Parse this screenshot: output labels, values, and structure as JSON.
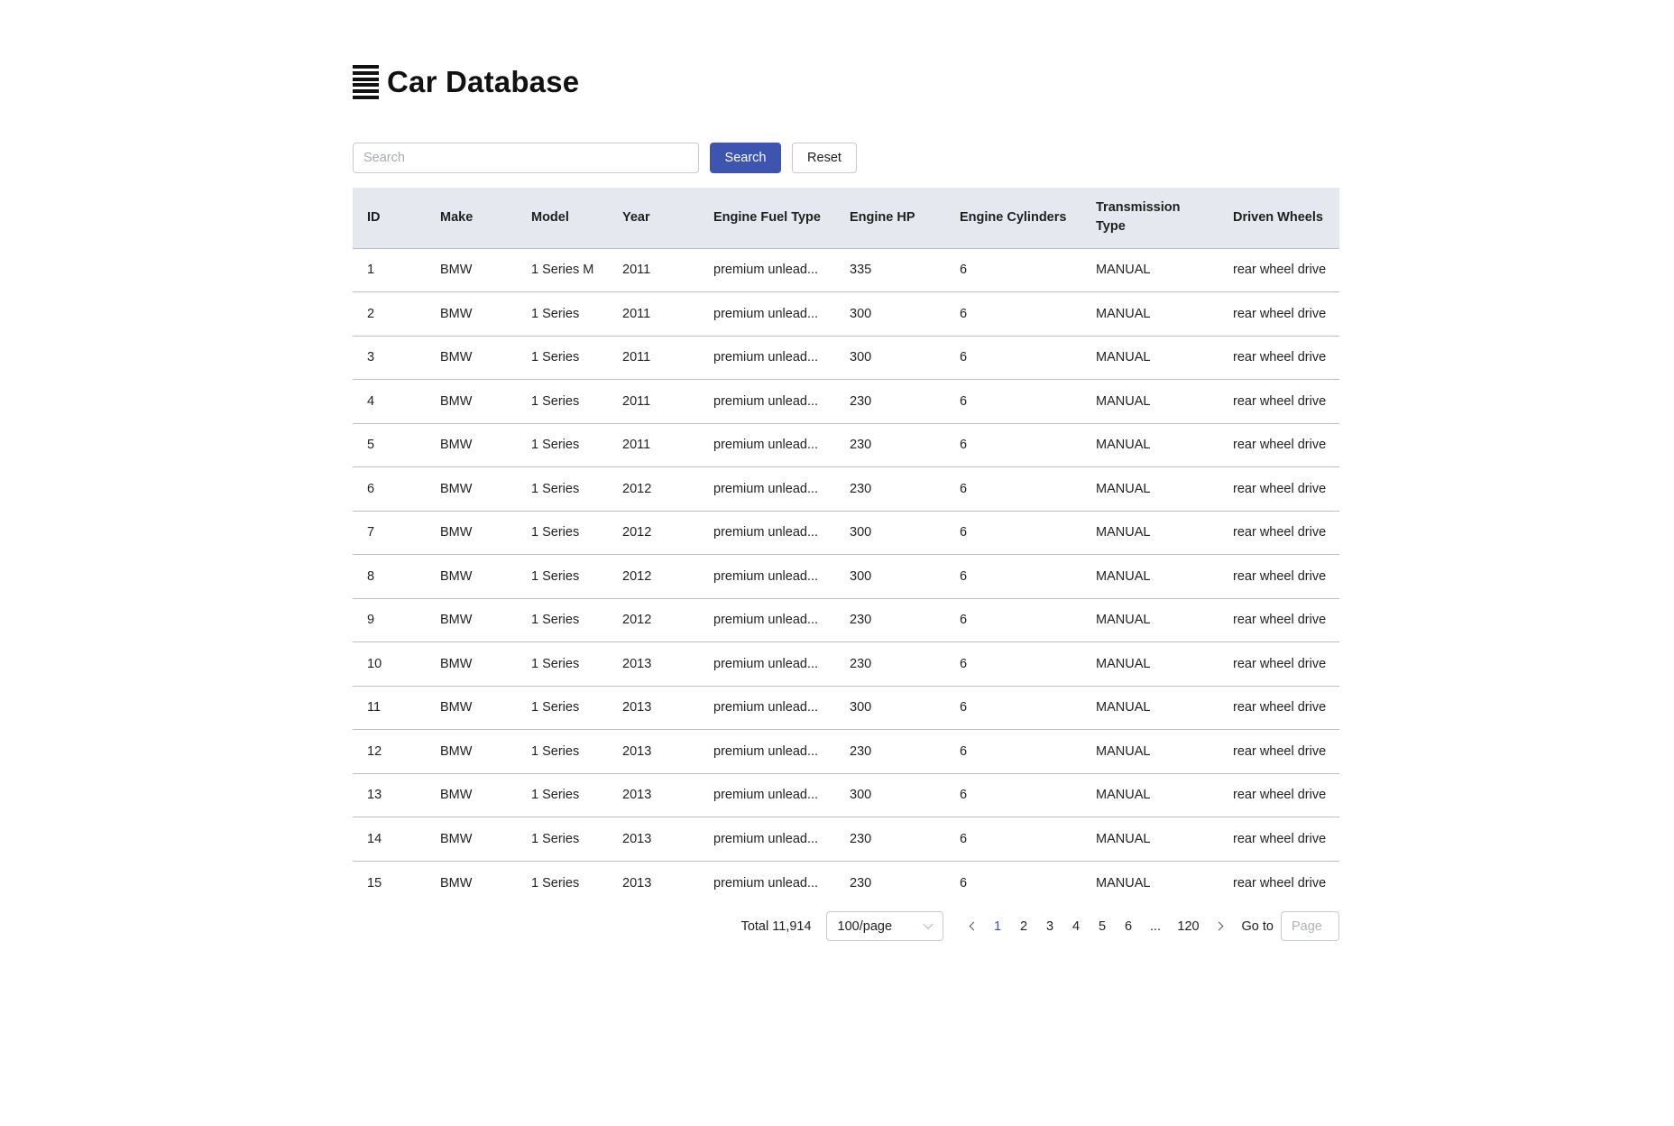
{
  "header": {
    "icon": "list-lines-icon",
    "title": "Car Database"
  },
  "search": {
    "placeholder": "Search",
    "value": "",
    "search_label": "Search",
    "reset_label": "Reset"
  },
  "colors": {
    "accent": "#3e55b0",
    "header_bg": "#e6e8ef"
  },
  "table": {
    "columns": [
      "ID",
      "Make",
      "Model",
      "Year",
      "Engine Fuel Type",
      "Engine HP",
      "Engine Cylinders",
      "Transmission Type",
      "Driven Wheels"
    ],
    "rows": [
      [
        "1",
        "BMW",
        "1 Series M",
        "2011",
        "premium unlead...",
        "335",
        "6",
        "MANUAL",
        "rear wheel drive"
      ],
      [
        "2",
        "BMW",
        "1 Series",
        "2011",
        "premium unlead...",
        "300",
        "6",
        "MANUAL",
        "rear wheel drive"
      ],
      [
        "3",
        "BMW",
        "1 Series",
        "2011",
        "premium unlead...",
        "300",
        "6",
        "MANUAL",
        "rear wheel drive"
      ],
      [
        "4",
        "BMW",
        "1 Series",
        "2011",
        "premium unlead...",
        "230",
        "6",
        "MANUAL",
        "rear wheel drive"
      ],
      [
        "5",
        "BMW",
        "1 Series",
        "2011",
        "premium unlead...",
        "230",
        "6",
        "MANUAL",
        "rear wheel drive"
      ],
      [
        "6",
        "BMW",
        "1 Series",
        "2012",
        "premium unlead...",
        "230",
        "6",
        "MANUAL",
        "rear wheel drive"
      ],
      [
        "7",
        "BMW",
        "1 Series",
        "2012",
        "premium unlead...",
        "300",
        "6",
        "MANUAL",
        "rear wheel drive"
      ],
      [
        "8",
        "BMW",
        "1 Series",
        "2012",
        "premium unlead...",
        "300",
        "6",
        "MANUAL",
        "rear wheel drive"
      ],
      [
        "9",
        "BMW",
        "1 Series",
        "2012",
        "premium unlead...",
        "230",
        "6",
        "MANUAL",
        "rear wheel drive"
      ],
      [
        "10",
        "BMW",
        "1 Series",
        "2013",
        "premium unlead...",
        "230",
        "6",
        "MANUAL",
        "rear wheel drive"
      ],
      [
        "11",
        "BMW",
        "1 Series",
        "2013",
        "premium unlead...",
        "300",
        "6",
        "MANUAL",
        "rear wheel drive"
      ],
      [
        "12",
        "BMW",
        "1 Series",
        "2013",
        "premium unlead...",
        "230",
        "6",
        "MANUAL",
        "rear wheel drive"
      ],
      [
        "13",
        "BMW",
        "1 Series",
        "2013",
        "premium unlead...",
        "300",
        "6",
        "MANUAL",
        "rear wheel drive"
      ],
      [
        "14",
        "BMW",
        "1 Series",
        "2013",
        "premium unlead...",
        "230",
        "6",
        "MANUAL",
        "rear wheel drive"
      ],
      [
        "15",
        "BMW",
        "1 Series",
        "2013",
        "premium unlead...",
        "230",
        "6",
        "MANUAL",
        "rear wheel drive"
      ]
    ]
  },
  "pagination": {
    "total_label": "Total 11,914",
    "page_size": "100/page",
    "prev_icon": "chevron-left-icon",
    "next_icon": "chevron-right-icon",
    "pages": [
      "1",
      "2",
      "3",
      "4",
      "5",
      "6",
      "...",
      "120"
    ],
    "current_page": "1",
    "goto_label": "Go to",
    "goto_placeholder": "Page"
  }
}
